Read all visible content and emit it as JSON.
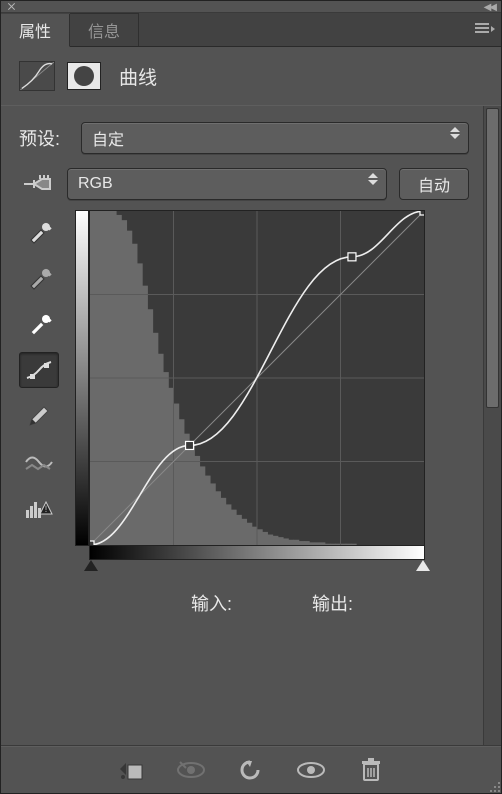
{
  "tabs": {
    "properties": "属性",
    "info": "信息"
  },
  "header": {
    "title": "曲线"
  },
  "preset": {
    "label": "预设:",
    "value": "自定"
  },
  "channel": {
    "value": "RGB"
  },
  "auto_button": "自动",
  "input_label": "输入:",
  "output_label": "输出:",
  "input_value": "",
  "output_value": "",
  "tools": {
    "eyedropper_black": "black-point-eyedropper",
    "eyedropper_gray": "gray-point-eyedropper",
    "eyedropper_white": "white-point-eyedropper",
    "curve_edit": "curve-point-tool",
    "pencil": "pencil-tool",
    "smooth": "smooth-tool",
    "histogram_clip": "clip-warning-tool"
  },
  "footer_icons": {
    "clip": "clip-to-layer",
    "view_previous": "view-previous-state",
    "reset": "reset",
    "visibility": "toggle-visibility",
    "delete": "delete"
  },
  "chart_data": {
    "type": "line",
    "title": "",
    "xlabel": "输入",
    "ylabel": "输出",
    "xlim": [
      0,
      255
    ],
    "ylim": [
      0,
      255
    ],
    "series": [
      {
        "name": "baseline",
        "x": [
          0,
          255
        ],
        "y": [
          0,
          255
        ]
      },
      {
        "name": "curve",
        "x": [
          0,
          76,
          200,
          255
        ],
        "y": [
          0,
          76,
          220,
          255
        ],
        "control_points": [
          [
            0,
            0
          ],
          [
            76,
            76
          ],
          [
            200,
            220
          ],
          [
            255,
            255
          ]
        ]
      }
    ],
    "histogram": {
      "description": "Background luminance histogram, heavy concentration in shadows (0-60) tapering to near-zero past midtones",
      "bins": 64,
      "values": [
        255,
        255,
        255,
        255,
        255,
        252,
        248,
        240,
        230,
        215,
        198,
        180,
        162,
        146,
        132,
        120,
        108,
        96,
        85,
        76,
        68,
        60,
        53,
        47,
        41,
        36,
        31,
        27,
        23,
        20,
        17,
        14,
        12,
        10,
        8,
        7,
        6,
        5,
        4,
        4,
        3,
        3,
        2,
        2,
        2,
        1,
        1,
        1,
        1,
        1,
        1,
        0,
        0,
        0,
        0,
        0,
        0,
        0,
        0,
        0,
        0,
        0,
        0,
        0
      ]
    },
    "black_point": 0,
    "white_point": 255
  }
}
